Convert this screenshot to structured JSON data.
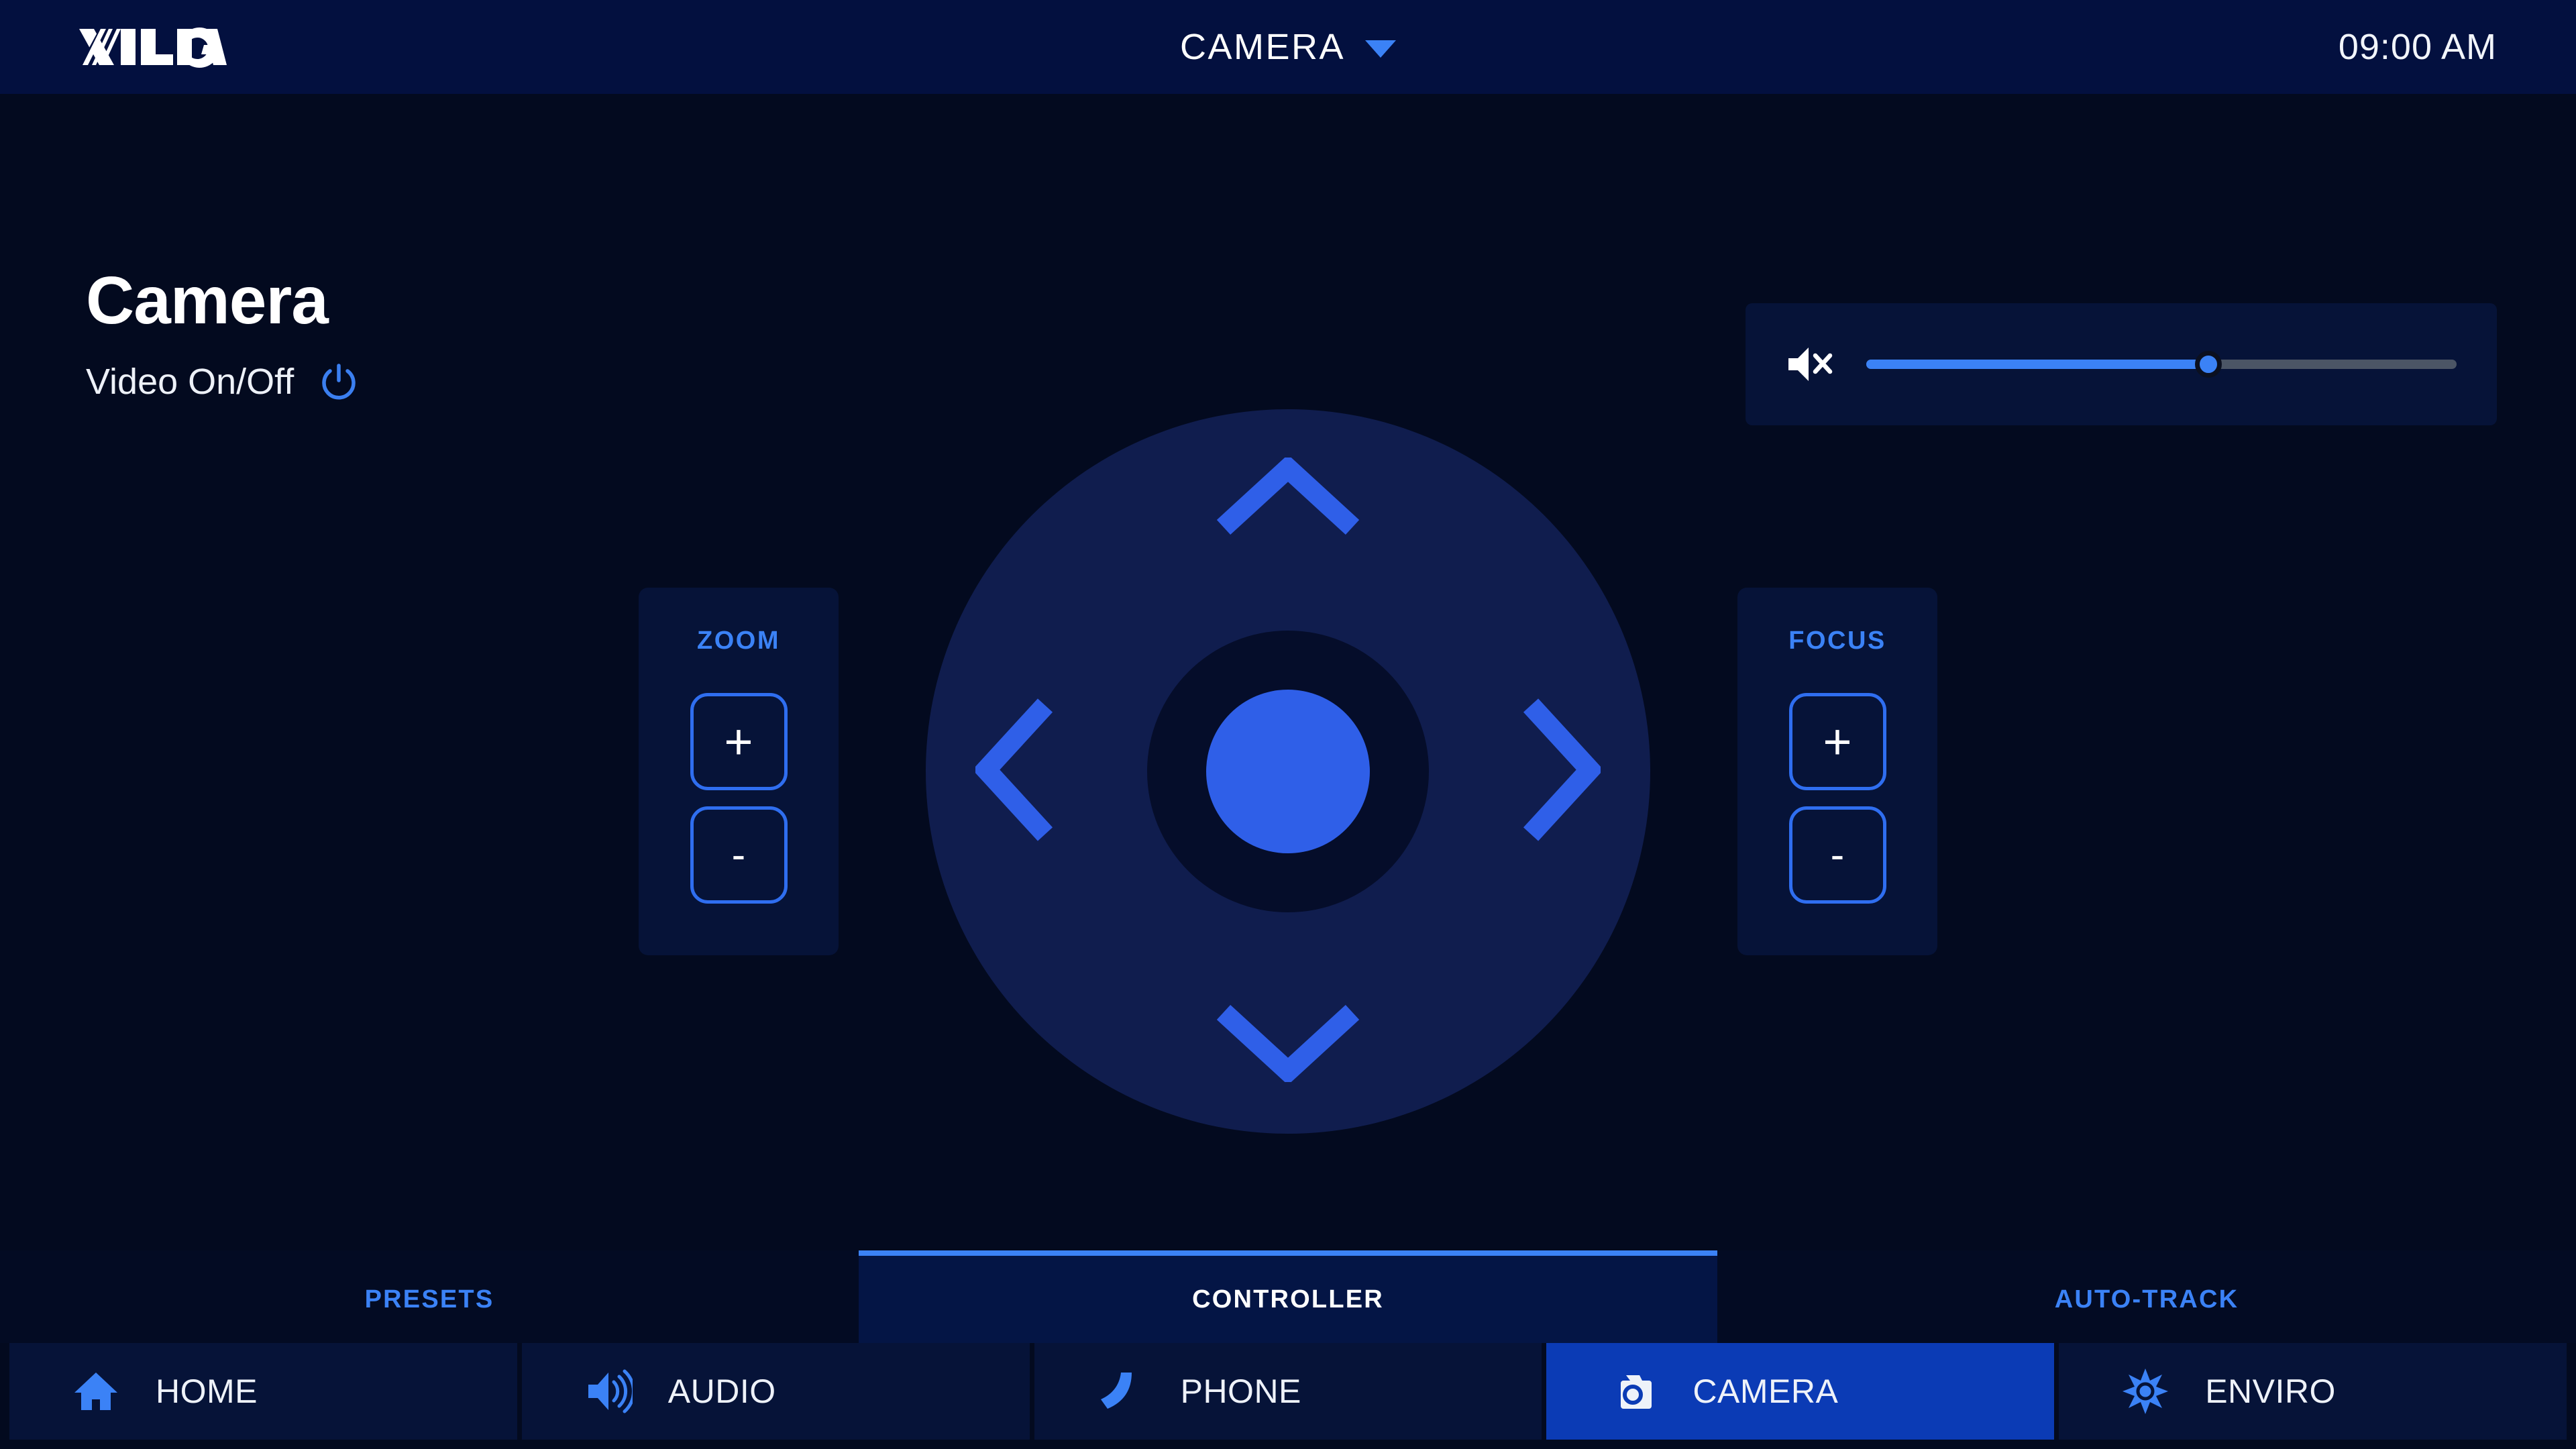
{
  "header": {
    "logo_text": "XILICA",
    "title": "CAMERA",
    "caret_icon": "chevron-down-icon",
    "clock": "09:00 AM"
  },
  "page": {
    "title": "Camera",
    "video_toggle_label": "Video On/Off",
    "power_icon": "power-icon"
  },
  "volume": {
    "mute_icon": "speaker-mute-icon",
    "level_percent": 58,
    "fill_color": "#3b82f6",
    "track_color": "#4b5565"
  },
  "zoom_panel": {
    "label": "ZOOM",
    "plus_label": "+",
    "minus_label": "-"
  },
  "focus_panel": {
    "label": "FOCUS",
    "plus_label": "+",
    "minus_label": "-"
  },
  "dpad": {
    "up_icon": "chevron-up-icon",
    "down_icon": "chevron-down-icon",
    "left_icon": "chevron-left-icon",
    "right_icon": "chevron-right-icon",
    "center_icon": "home-position-dot"
  },
  "tabs": [
    {
      "label": "PRESETS",
      "active": false
    },
    {
      "label": "CONTROLLER",
      "active": true
    },
    {
      "label": "AUTO-TRACK",
      "active": false
    }
  ],
  "bottom_nav": [
    {
      "label": "HOME",
      "icon": "home-icon",
      "active": false
    },
    {
      "label": "AUDIO",
      "icon": "speaker-waves-icon",
      "active": false
    },
    {
      "label": "PHONE",
      "icon": "phone-icon",
      "active": false
    },
    {
      "label": "CAMERA",
      "icon": "camera-icon",
      "active": true
    },
    {
      "label": "ENVIRO",
      "icon": "sun-icon",
      "active": false
    }
  ],
  "colors": {
    "background": "#030a1f",
    "header_bg": "#03103f",
    "panel_bg": "#061338",
    "accent_blue": "#3b82f6",
    "active_nav_bg": "#0b3bb5",
    "dpad_disc": "#101d4e",
    "dpad_center": "#2f5fe8"
  }
}
